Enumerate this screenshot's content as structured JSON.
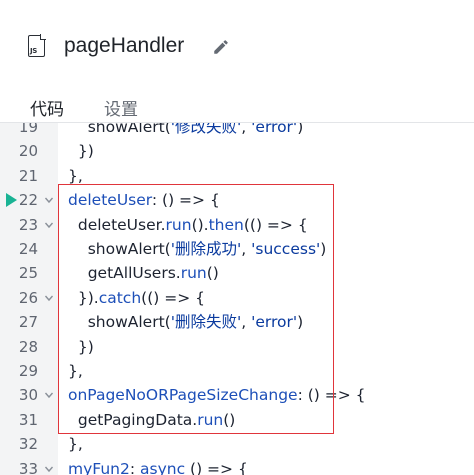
{
  "header": {
    "file_icon_text": "JS",
    "file_icon": "js-file-icon",
    "title": "pageHandler",
    "edit_icon": "pencil-icon"
  },
  "tabs": [
    {
      "label": "代码",
      "active": true
    },
    {
      "label": "设置",
      "active": false
    }
  ],
  "colors": {
    "highlight_border": "#e0353b",
    "breakpoint_marker": "#19b394",
    "key_color": "#1d4fb8",
    "string_color": "#0a3a9e",
    "gutter_bg": "#f3f4f5"
  },
  "code_lines": [
    {
      "num": "19",
      "fold": false,
      "tokens": [
        [
          "    ",
          "t-plain"
        ],
        [
          "showAlert",
          "t-plain"
        ],
        [
          "(",
          "t-punc"
        ],
        [
          "'修改失败'",
          "t-str"
        ],
        [
          ", ",
          "t-punc"
        ],
        [
          "'error'",
          "t-str"
        ],
        [
          ")",
          "t-punc"
        ]
      ]
    },
    {
      "num": "20",
      "fold": false,
      "tokens": [
        [
          "  })",
          "t-punc"
        ]
      ]
    },
    {
      "num": "21",
      "fold": false,
      "tokens": [
        [
          "},",
          "t-punc"
        ]
      ]
    },
    {
      "num": "22",
      "fold": true,
      "marker": true,
      "tokens": [
        [
          "deleteUser",
          "t-key"
        ],
        [
          ": () => {",
          "t-punc"
        ]
      ]
    },
    {
      "num": "23",
      "fold": true,
      "tokens": [
        [
          "  deleteUser.",
          "t-plain"
        ],
        [
          "run",
          "t-key"
        ],
        [
          "().",
          "t-punc"
        ],
        [
          "then",
          "t-key"
        ],
        [
          "(() => {",
          "t-punc"
        ]
      ]
    },
    {
      "num": "24",
      "fold": false,
      "tokens": [
        [
          "    showAlert",
          "t-plain"
        ],
        [
          "(",
          "t-punc"
        ],
        [
          "'删除成功'",
          "t-str"
        ],
        [
          ", ",
          "t-punc"
        ],
        [
          "'success'",
          "t-str"
        ],
        [
          ")",
          "t-punc"
        ]
      ]
    },
    {
      "num": "25",
      "fold": false,
      "tokens": [
        [
          "    getAllUsers.",
          "t-plain"
        ],
        [
          "run",
          "t-key"
        ],
        [
          "()",
          "t-punc"
        ]
      ]
    },
    {
      "num": "26",
      "fold": true,
      "tokens": [
        [
          "  }).",
          "t-punc"
        ],
        [
          "catch",
          "t-key"
        ],
        [
          "(() => {",
          "t-punc"
        ]
      ]
    },
    {
      "num": "27",
      "fold": false,
      "tokens": [
        [
          "    showAlert",
          "t-plain"
        ],
        [
          "(",
          "t-punc"
        ],
        [
          "'删除失败'",
          "t-str"
        ],
        [
          ", ",
          "t-punc"
        ],
        [
          "'error'",
          "t-str"
        ],
        [
          ")",
          "t-punc"
        ]
      ]
    },
    {
      "num": "28",
      "fold": false,
      "tokens": [
        [
          "  })",
          "t-punc"
        ]
      ]
    },
    {
      "num": "29",
      "fold": false,
      "tokens": [
        [
          "},",
          "t-punc"
        ]
      ]
    },
    {
      "num": "30",
      "fold": true,
      "tokens": [
        [
          "onPageNoORPageSizeChange",
          "t-key"
        ],
        [
          ": () => {",
          "t-punc"
        ]
      ]
    },
    {
      "num": "31",
      "fold": false,
      "tokens": [
        [
          "  getPagingData.",
          "t-plain"
        ],
        [
          "run",
          "t-key"
        ],
        [
          "()",
          "t-punc"
        ]
      ]
    },
    {
      "num": "32",
      "fold": false,
      "tokens": [
        [
          "},",
          "t-punc"
        ]
      ]
    },
    {
      "num": "33",
      "fold": true,
      "tokens": [
        [
          "myFun2",
          "t-key"
        ],
        [
          ": ",
          "t-punc"
        ],
        [
          "async",
          "t-key"
        ],
        [
          " () => {",
          "t-punc"
        ]
      ]
    }
  ]
}
